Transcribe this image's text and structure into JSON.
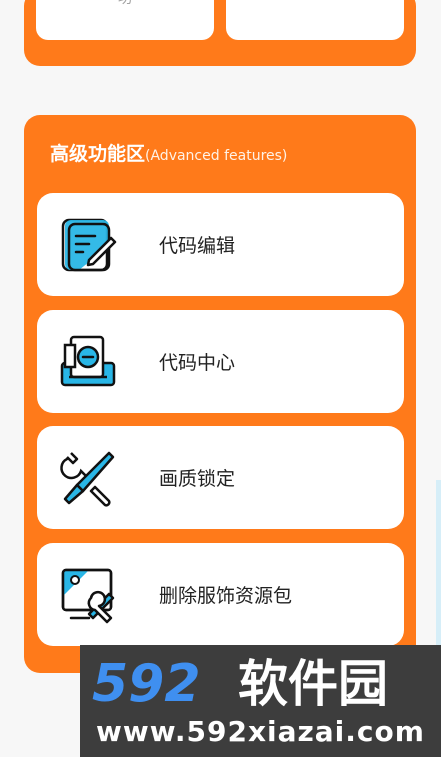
{
  "top_card": {
    "left_label": "功",
    "right_label": "..."
  },
  "section": {
    "title": "高级功能区",
    "subtitle": "(Advanced features)",
    "items": [
      {
        "label": "代码编辑",
        "icon": "code-edit-icon"
      },
      {
        "label": "代码中心",
        "icon": "code-center-icon"
      },
      {
        "label": "画质锁定",
        "icon": "wrench-screwdriver-icon"
      },
      {
        "label": "删除服饰资源包",
        "icon": "delete-resource-icon"
      }
    ]
  },
  "watermark": {
    "logo_text": "592软件园",
    "url": "www.592xiazai.com"
  },
  "colors": {
    "accent": "#ff7a1a",
    "icon_blue": "#29b6e6",
    "card_bg": "#ffffff",
    "watermark_bg": "#3d3d3d"
  }
}
